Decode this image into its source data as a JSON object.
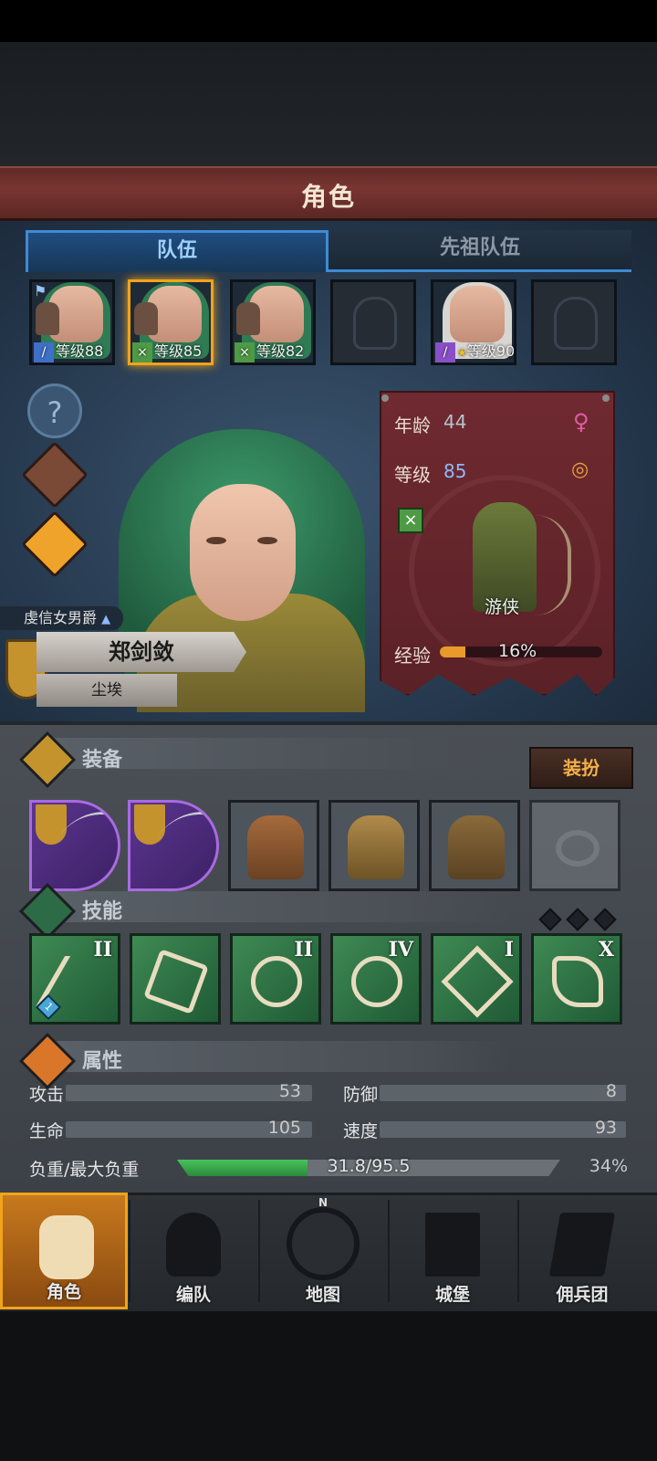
{
  "header": {
    "title": "角色"
  },
  "tabs": [
    {
      "label": "队伍",
      "active": true
    },
    {
      "label": "先祖队伍",
      "active": false
    }
  ],
  "party": [
    {
      "level": "等级88",
      "class_icon": "sword-icon",
      "hair": "green",
      "selected": false
    },
    {
      "level": "等级85",
      "class_icon": "bow-icon",
      "hair": "green",
      "selected": true
    },
    {
      "level": "等级82",
      "class_icon": "bow-icon",
      "hair": "green",
      "selected": false
    },
    {
      "level": "",
      "class_icon": "empty-helmet-icon",
      "hair": "",
      "selected": false
    },
    {
      "level": "等级90",
      "class_icon": "staff-icon",
      "hair": "white",
      "selected": false
    },
    {
      "level": "",
      "class_icon": "empty-helmet-icon",
      "hair": "",
      "selected": false
    }
  ],
  "character": {
    "title": "虔信女男爵",
    "name": "郑剑敛",
    "origin": "尘埃",
    "age_label": "年龄",
    "age": "44",
    "level_label": "等级",
    "level": "85",
    "class_name": "游侠",
    "xp_label": "经验",
    "xp_percent": "16%",
    "xp_fraction": 0.16
  },
  "equipment": {
    "title": "装备",
    "dress_button": "装扮",
    "slots": [
      "bow-icon",
      "bow-icon",
      "helmet-icon",
      "armor-icon",
      "boots-icon",
      "ring-icon"
    ]
  },
  "skills": {
    "title": "技能",
    "items": [
      {
        "rank": "II",
        "icon": "arrows-icon",
        "gem": "1"
      },
      {
        "rank": "",
        "icon": "dash-icon",
        "gem": ""
      },
      {
        "rank": "II",
        "icon": "target-burst-icon",
        "gem": ""
      },
      {
        "rank": "IV",
        "icon": "crosshair-icon",
        "gem": ""
      },
      {
        "rank": "I",
        "icon": "burst-icon",
        "gem": ""
      },
      {
        "rank": "X",
        "icon": "claw-icon",
        "gem": ""
      }
    ]
  },
  "attributes": {
    "title": "属性",
    "attack_label": "攻击",
    "attack": "53",
    "defense_label": "防御",
    "defense": "8",
    "hp_label": "生命",
    "hp": "105",
    "speed_label": "速度",
    "speed": "93",
    "load_label": "负重/最大负重",
    "load": "31.8/95.5",
    "load_percent": "34%",
    "load_fraction": 0.34
  },
  "nav": [
    {
      "label": "角色",
      "icon": "knight-icon",
      "active": true
    },
    {
      "label": "编队",
      "icon": "helmet-crest-icon",
      "active": false
    },
    {
      "label": "地图",
      "icon": "compass-map-icon",
      "active": false
    },
    {
      "label": "城堡",
      "icon": "castle-icon",
      "active": false
    },
    {
      "label": "佣兵团",
      "icon": "banner-icon",
      "active": false
    }
  ],
  "compass_letter": "N",
  "colors": {
    "accent": "#f2a31b",
    "tab_blue": "#3f8ad3",
    "banner_red": "#6f2a30"
  }
}
